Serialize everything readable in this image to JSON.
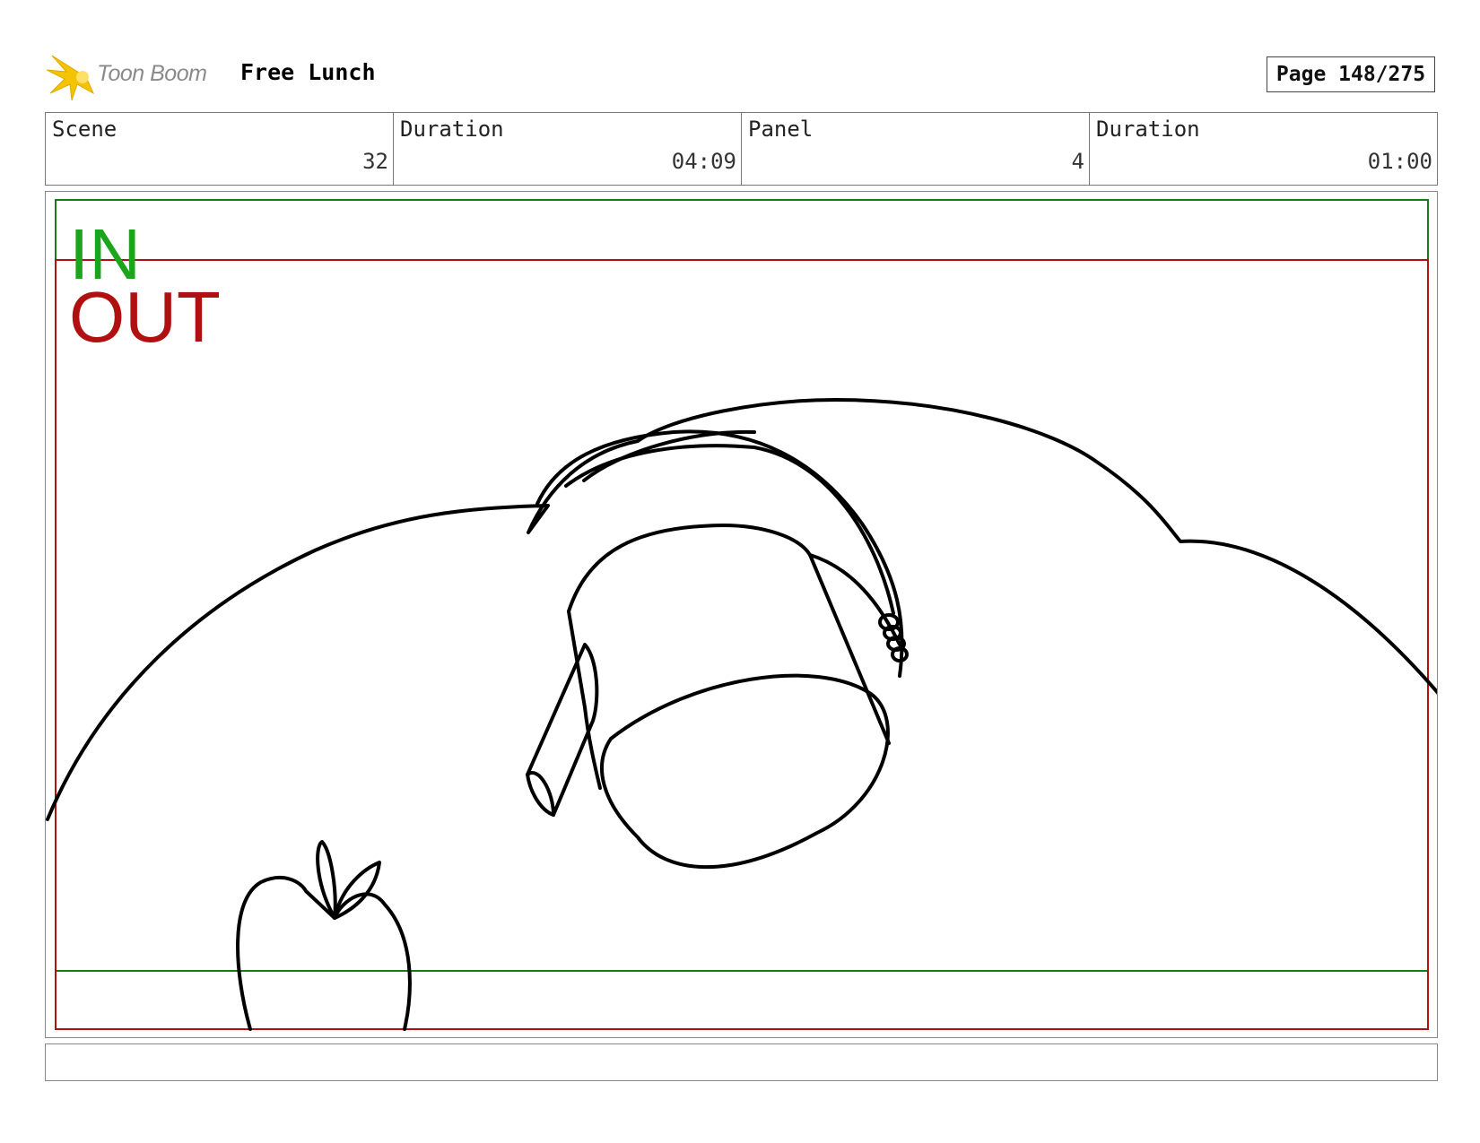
{
  "header": {
    "logo_text": "Toon Boom",
    "project_title": "Free Lunch",
    "page_label": "Page 148/275"
  },
  "info": [
    {
      "label": "Scene",
      "value": "32"
    },
    {
      "label": "Duration",
      "value": "04:09"
    },
    {
      "label": "Panel",
      "value": "4"
    },
    {
      "label": "Duration",
      "value": "01:00"
    }
  ],
  "panel": {
    "in_label": "IN",
    "out_label": "OUT",
    "in_color": "#1aa51a",
    "out_color": "#b01010"
  },
  "caption": {
    "text": ""
  },
  "colors": {
    "logo_star": "#f5c400"
  }
}
